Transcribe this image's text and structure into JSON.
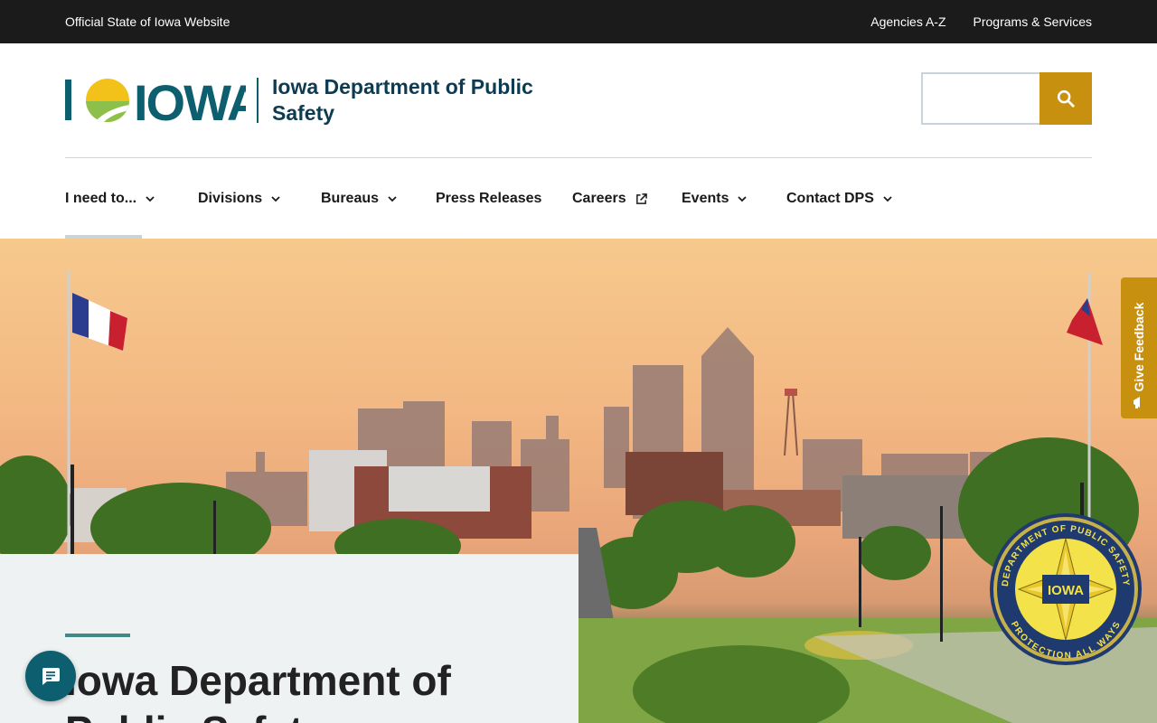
{
  "topbar": {
    "official_label": "Official State of Iowa Website",
    "links": [
      "Agencies A-Z",
      "Programs & Services"
    ]
  },
  "header": {
    "logo_text": "IOWA",
    "department_name": "Iowa Department of Public Safety",
    "search_placeholder": "",
    "search_icon": "search-icon"
  },
  "nav": {
    "items": [
      {
        "label": "I need to...",
        "icon": "chevron-down-icon"
      },
      {
        "label": "Divisions",
        "icon": "chevron-down-icon"
      },
      {
        "label": "Bureaus",
        "icon": "chevron-down-icon"
      },
      {
        "label": "Press Releases"
      },
      {
        "label": "Careers",
        "icon": "external-link-icon"
      },
      {
        "label": "Events",
        "icon": "chevron-down-icon"
      },
      {
        "label": "Contact DPS",
        "icon": "chevron-down-icon"
      }
    ]
  },
  "feedback": {
    "label": "Give Feedback",
    "icon": "megaphone-icon"
  },
  "intro": {
    "title": "Iowa Department of Public Safety"
  },
  "chat": {
    "icon": "chat-icon"
  },
  "seal": {
    "ring_text": "DEPARTMENT OF PUBLIC SAFETY",
    "bottom_text": "PROTECTION ALL WAYS",
    "center_text": "IOWA"
  },
  "colors": {
    "topbar_bg": "#1b1b1b",
    "brand_teal": "#0d5f6f",
    "accent_gold": "#c7900f",
    "dept_name": "#0d3b52",
    "card_bg": "#eff2f3"
  }
}
